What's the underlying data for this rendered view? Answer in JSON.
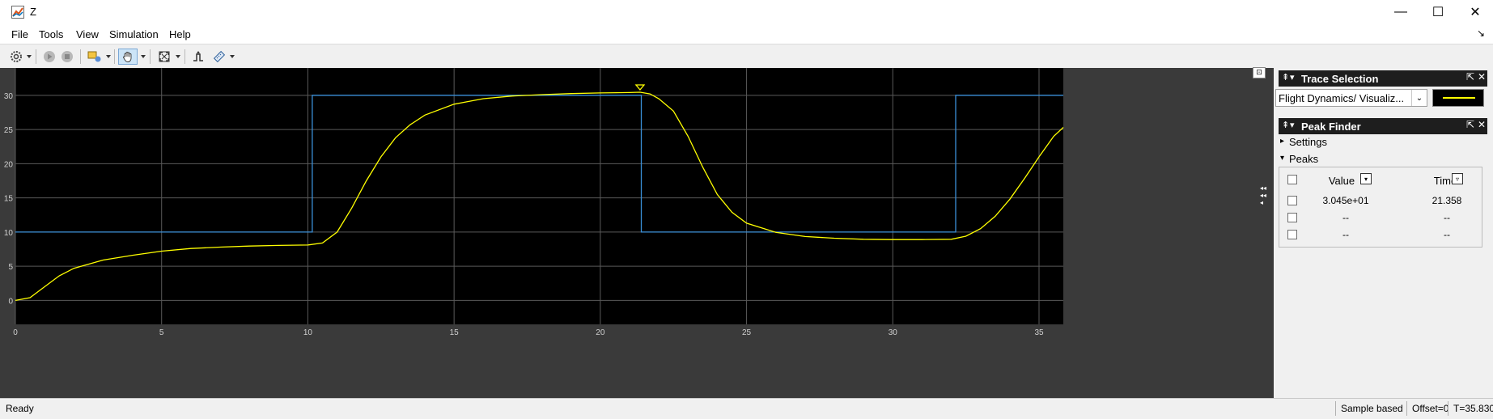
{
  "window": {
    "title": "Z",
    "minimize_glyph": "—",
    "maximize_glyph": "☐",
    "close_glyph": "✕"
  },
  "menu": [
    {
      "label": "File"
    },
    {
      "label": "Tools"
    },
    {
      "label": "View"
    },
    {
      "label": "Simulation"
    },
    {
      "label": "Help"
    }
  ],
  "menubar": {
    "undock_glyph": "↘"
  },
  "toolbar": {
    "icons": [
      "settings-icon",
      "run-icon",
      "stop-icon",
      "layout-icon",
      "pan-hand-icon",
      "zoom-fit-icon",
      "triggers-icon",
      "measurement-icon"
    ]
  },
  "plot": {
    "background": "#000000",
    "frame_color": "#3a3a3a",
    "grid_color": "#5a5a5a",
    "tick_color": "#d0d0d0",
    "expand_glyph": "⊡",
    "collapse_arrows": "◂◂◂◂◂"
  },
  "chart_data": {
    "type": "line",
    "xlim": [
      0,
      35.83
    ],
    "ylim": [
      -3.5,
      34
    ],
    "xticks": [
      0,
      5,
      10,
      15,
      20,
      25,
      30,
      35
    ],
    "yticks": [
      0,
      5,
      10,
      15,
      20,
      25,
      30
    ],
    "grid": true,
    "series": [
      {
        "color": "#3a8fd8",
        "x": [
          0,
          10.15,
          10.15,
          21.4,
          21.4,
          32.15,
          32.15,
          35.83
        ],
        "y": [
          10,
          10,
          30,
          30,
          10,
          10,
          30,
          30
        ]
      },
      {
        "color": "#ffff00",
        "x": [
          0,
          0.5,
          1,
          1.5,
          2,
          3,
          4,
          5,
          6,
          7,
          8,
          9,
          10,
          10.5,
          11,
          11.5,
          12,
          12.5,
          13,
          13.5,
          14,
          15,
          16,
          17,
          18,
          19,
          20,
          21,
          21.36,
          21.7,
          22,
          22.5,
          23,
          23.5,
          24,
          24.5,
          25,
          26,
          27,
          28,
          29,
          30,
          31,
          32,
          32.5,
          33,
          33.5,
          34,
          34.5,
          35,
          35.5,
          35.83
        ],
        "y": [
          0,
          0.4,
          2,
          3.6,
          4.7,
          5.9,
          6.6,
          7.2,
          7.6,
          7.8,
          7.95,
          8.05,
          8.1,
          8.4,
          10,
          13.5,
          17.5,
          21,
          23.8,
          25.7,
          27.1,
          28.7,
          29.5,
          29.9,
          30.1,
          30.25,
          30.35,
          30.4,
          30.45,
          30.2,
          29.5,
          27.7,
          24,
          19.5,
          15.5,
          12.9,
          11.3,
          9.95,
          9.35,
          9.1,
          8.95,
          8.9,
          8.9,
          8.95,
          9.4,
          10.5,
          12.3,
          14.8,
          17.8,
          21,
          24,
          25.3
        ]
      }
    ],
    "peak_marker": {
      "x": 21.358,
      "y": 30.45,
      "color": "#ffff00"
    }
  },
  "trace_selection": {
    "title": "Trace Selection",
    "selected_signal": "Flight Dynamics/ Visualiz...",
    "swatch_color": "#ffff00"
  },
  "peak_finder": {
    "title": "Peak Finder",
    "settings_label": "Settings",
    "peaks_label": "Peaks",
    "columns": [
      "Value",
      "Time"
    ],
    "rows": [
      [
        "3.045e+01",
        "21.358"
      ],
      [
        "--",
        "--"
      ],
      [
        "--",
        "--"
      ]
    ]
  },
  "panel_glyphs": {
    "pin": "⇞",
    "menu": "▾",
    "undock": "⇱",
    "close": "✕",
    "expanded": "▾",
    "collapsed": "▸"
  },
  "status": {
    "ready": "Ready",
    "mode": "Sample based",
    "offset": "Offset=0",
    "time": "T=35.830"
  }
}
